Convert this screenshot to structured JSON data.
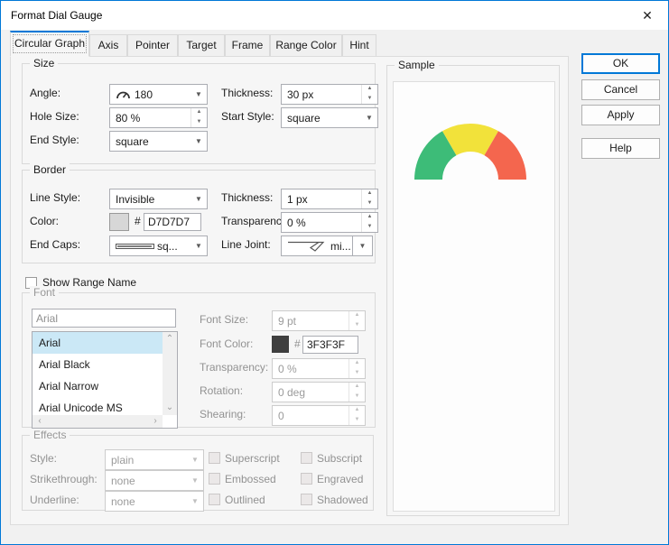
{
  "window": {
    "title": "Format Dial Gauge"
  },
  "icons": {
    "close": "✕",
    "dropdown": "▼",
    "spin_up": "▲",
    "spin_down": "▼",
    "scroll_up": "⌃",
    "scroll_down": "⌄",
    "scroll_left": "‹",
    "scroll_right": "›"
  },
  "tabs": [
    "Circular Graph",
    "Axis",
    "Pointer",
    "Target",
    "Frame",
    "Range Color",
    "Hint"
  ],
  "size_group": {
    "title": "Size",
    "angle": {
      "label": "Angle:",
      "value": "180"
    },
    "thickness": {
      "label": "Thickness:",
      "value": "30 px"
    },
    "hole_size": {
      "label": "Hole Size:",
      "value": "80 %"
    },
    "start_style": {
      "label": "Start Style:",
      "value": "square"
    },
    "end_style": {
      "label": "End Style:",
      "value": "square"
    }
  },
  "border_group": {
    "title": "Border",
    "line_style": {
      "label": "Line Style:",
      "value": "Invisible"
    },
    "thickness": {
      "label": "Thickness:",
      "value": "1 px"
    },
    "color": {
      "label": "Color:",
      "hash": "#",
      "value": "D7D7D7",
      "swatch": "#D7D7D7"
    },
    "transparency": {
      "label": "Transparency:",
      "value": "0 %"
    },
    "end_caps": {
      "label": "End Caps:",
      "value": "sq..."
    },
    "line_joint": {
      "label": "Line Joint:",
      "value": "mi..."
    }
  },
  "show_range_name": {
    "label": "Show Range Name",
    "checked": false
  },
  "font_group": {
    "title": "Font",
    "name_value": "Arial",
    "list": [
      "Arial",
      "Arial Black",
      "Arial Narrow",
      "Arial Unicode MS"
    ],
    "selected_index": 0,
    "font_size": {
      "label": "Font Size:",
      "value": "9 pt"
    },
    "font_color": {
      "label": "Font Color:",
      "hash": "#",
      "value": "3F3F3F",
      "swatch": "#3F3F3F"
    },
    "transparency": {
      "label": "Transparency:",
      "value": "0 %"
    },
    "rotation": {
      "label": "Rotation:",
      "value": "0 deg"
    },
    "shearing": {
      "label": "Shearing:",
      "value": "0"
    }
  },
  "effects_group": {
    "title": "Effects",
    "style": {
      "label": "Style:",
      "value": "plain"
    },
    "strikethrough": {
      "label": "Strikethrough:",
      "value": "none"
    },
    "underline": {
      "label": "Underline:",
      "value": "none"
    },
    "checkboxes": [
      "Superscript",
      "Subscript",
      "Embossed",
      "Engraved",
      "Outlined",
      "Shadowed"
    ]
  },
  "sample_group": {
    "title": "Sample",
    "gauge": {
      "type": "dial-gauge-preview",
      "angle_span_deg": 180,
      "segments": [
        {
          "name": "green",
          "color": "#3dbc78",
          "from_deg": 180,
          "to_deg": 120
        },
        {
          "name": "yellow",
          "color": "#f2e23a",
          "from_deg": 120,
          "to_deg": 60
        },
        {
          "name": "red",
          "color": "#f4664e",
          "from_deg": 60,
          "to_deg": 0
        }
      ]
    }
  },
  "buttons": {
    "ok": "OK",
    "cancel": "Cancel",
    "apply": "Apply",
    "help": "Help"
  }
}
